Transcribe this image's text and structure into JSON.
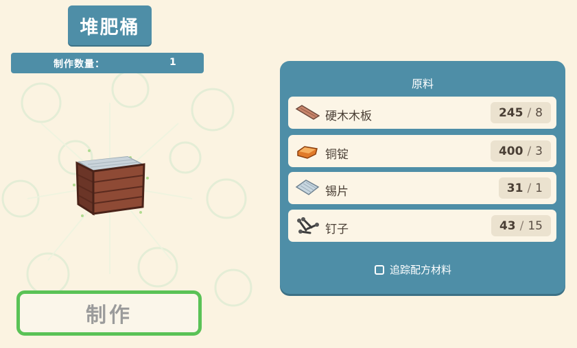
{
  "item": {
    "title": "堆肥桶",
    "icon": "compost-bin-icon"
  },
  "quantity": {
    "label": "制作数量：",
    "value": "1"
  },
  "craft": {
    "label": "制作"
  },
  "materials": {
    "title": "原料",
    "items": [
      {
        "name": "硬木木板",
        "have": "245",
        "need": "8",
        "icon": "hardwood-plank-icon"
      },
      {
        "name": "铜锭",
        "have": "400",
        "need": "3",
        "icon": "copper-ingot-icon"
      },
      {
        "name": "锡片",
        "have": "31",
        "need": "1",
        "icon": "tin-sheet-icon"
      },
      {
        "name": "钉子",
        "have": "43",
        "need": "15",
        "icon": "nails-icon"
      }
    ],
    "track_label": "追踪配方材料"
  },
  "colors": {
    "accent": "#4e8ea7",
    "craft_border": "#5ac256",
    "background": "#fbf3e1"
  }
}
